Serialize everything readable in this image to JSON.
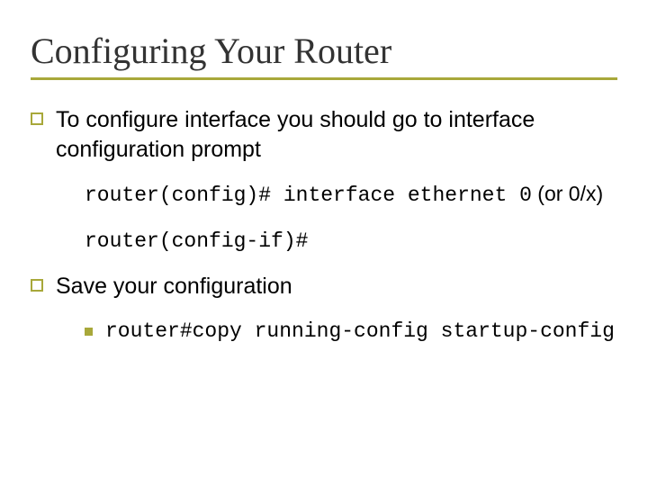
{
  "title": "Configuring Your Router",
  "bullets": [
    {
      "text": "To configure interface you should go to interface configuration prompt",
      "code_lines": [
        {
          "code": "router(config)# interface ethernet 0",
          "tail": " (or 0/x)"
        },
        {
          "code": "router(config-if)#",
          "tail": ""
        }
      ]
    },
    {
      "text": "Save your configuration",
      "sub_bullet": {
        "code": "router#copy running-config startup-config"
      }
    }
  ]
}
